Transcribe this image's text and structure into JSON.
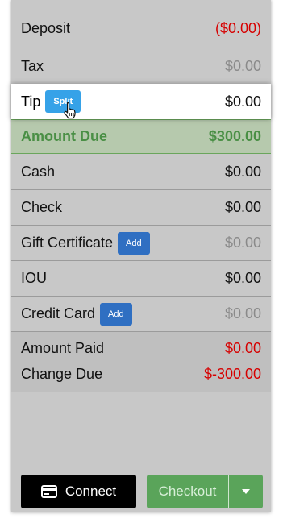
{
  "rows": {
    "deposit": {
      "label": "Deposit",
      "amount": "($0.00)"
    },
    "tax": {
      "label": "Tax",
      "amount": "$0.00"
    },
    "tip": {
      "label": "Tip",
      "button": "Split",
      "amount": "$0.00"
    },
    "amount_due": {
      "label": "Amount Due",
      "amount": "$300.00"
    },
    "cash": {
      "label": "Cash",
      "amount": "$0.00"
    },
    "check": {
      "label": "Check",
      "amount": "$0.00"
    },
    "gift_certificate": {
      "label": "Gift Certificate",
      "button": "Add",
      "amount": "$0.00"
    },
    "iou": {
      "label": "IOU",
      "amount": "$0.00"
    },
    "credit_card": {
      "label": "Credit Card",
      "button": "Add",
      "amount": "$0.00"
    }
  },
  "summary": {
    "amount_paid": {
      "label": "Amount Paid",
      "amount": "$0.00"
    },
    "change_due": {
      "label": "Change Due",
      "amount": "$-300.00"
    }
  },
  "footer": {
    "connect_label": "Connect",
    "checkout_label": "Checkout"
  },
  "icons": {
    "connect": "card-reader-icon",
    "caret": "caret-down-icon",
    "cursor": "hand-pointer-icon"
  },
  "colors": {
    "negative": "#d60000",
    "muted": "#8a8a8a",
    "amount_due_green": "#4a8f45",
    "checkout_green": "#5aa45a",
    "split_blue": "#36a2e8",
    "add_blue": "#2f6fc2"
  }
}
